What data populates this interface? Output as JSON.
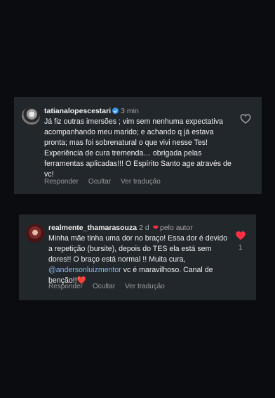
{
  "comments": [
    {
      "username": "tatianalopescestari",
      "verified": true,
      "time": "3 min",
      "text": "Já fiz outras imersões ; vim sem nenhuma expectativa acompanhando meu marido; e achando q já estava pronta; mas foi sobrenatural o que vivi nesse Tes! Experiência de cura tremenda… obrigada pelas ferramentas aplicadas!!! O Espírito Santo age através de vc!",
      "actions": {
        "reply": "Responder",
        "hide": "Ocultar",
        "translate": "Ver tradução"
      },
      "liked": false
    },
    {
      "username": "realmente_thamarasouza",
      "time": "2 d",
      "author_badge": "pelo autor",
      "text_before": "Minha mãe tinha uma dor no braço! Essa dor é devido a repetição (bursite), depois do TES ela está sem dores!! O braço está normal !! Muita cura, ",
      "mention": "@andersonluizmentor",
      "text_after": "  vc é maravilhoso. Canal de benção!!",
      "emoji": "❤️",
      "actions": {
        "reply": "Responder",
        "hide": "Ocultar",
        "translate": "Ver tradução"
      },
      "liked": true,
      "like_count": "1"
    }
  ],
  "colors": {
    "background": "#0a0c0f",
    "card": "#22272c",
    "like_red": "#ff3040",
    "mention": "#8fb5ea",
    "verified": "#3897f0"
  },
  "icons": [
    "heart-outline-icon",
    "heart-filled-icon",
    "verified-badge-icon",
    "small-heart-icon",
    "avatar"
  ]
}
